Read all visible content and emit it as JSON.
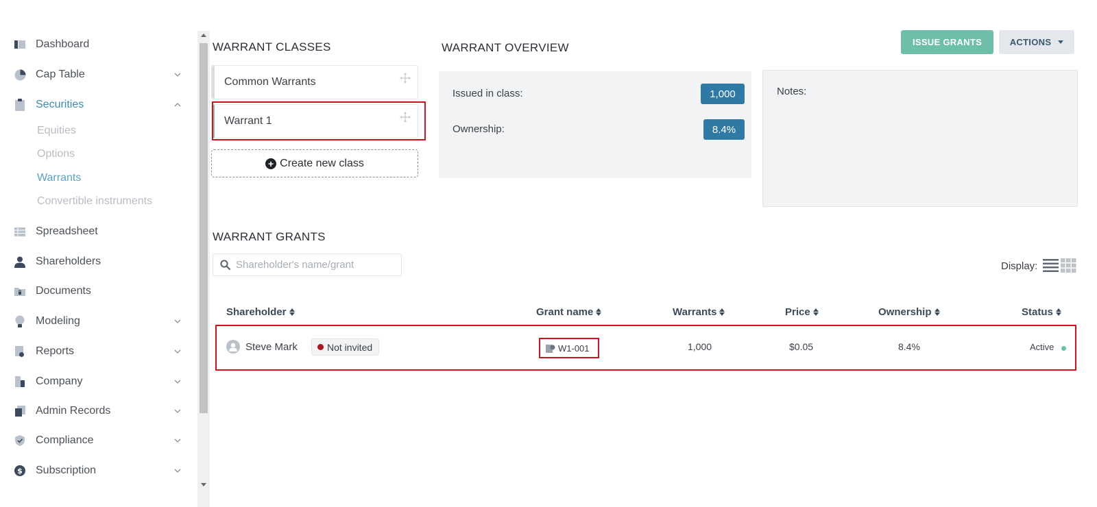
{
  "sidebar": {
    "items": [
      {
        "label": "Dashboard",
        "icon": "dashboard-icon",
        "has_chevron": false
      },
      {
        "label": "Cap Table",
        "icon": "pie-chart-icon",
        "has_chevron": true
      },
      {
        "label": "Securities",
        "icon": "clipboard-icon",
        "has_chevron": true,
        "expanded": true
      },
      {
        "label": "Spreadsheet",
        "icon": "spreadsheet-icon",
        "has_chevron": false
      },
      {
        "label": "Shareholders",
        "icon": "user-icon",
        "has_chevron": false
      },
      {
        "label": "Documents",
        "icon": "folder-lock-icon",
        "has_chevron": false
      },
      {
        "label": "Modeling",
        "icon": "lightbulb-icon",
        "has_chevron": true
      },
      {
        "label": "Reports",
        "icon": "report-icon",
        "has_chevron": true
      },
      {
        "label": "Company",
        "icon": "building-icon",
        "has_chevron": true
      },
      {
        "label": "Admin Records",
        "icon": "admin-records-icon",
        "has_chevron": true
      },
      {
        "label": "Compliance",
        "icon": "shield-check-icon",
        "has_chevron": true
      },
      {
        "label": "Subscription",
        "icon": "dollar-circle-icon",
        "has_chevron": true
      }
    ],
    "securities_sub": [
      {
        "label": "Equities",
        "active": false
      },
      {
        "label": "Options",
        "active": false
      },
      {
        "label": "Warrants",
        "active": true
      },
      {
        "label": "Convertible instruments",
        "active": false
      }
    ]
  },
  "classes": {
    "heading": "WARRANT CLASSES",
    "items": [
      {
        "label": "Common Warrants",
        "selected": false
      },
      {
        "label": "Warrant 1",
        "selected": true
      }
    ],
    "create_label": "Create new class"
  },
  "overview": {
    "heading": "WARRANT OVERVIEW",
    "issued_label": "Issued in class:",
    "issued_value": "1,000",
    "ownership_label": "Ownership:",
    "ownership_value": "8.4%",
    "notes_label": "Notes:"
  },
  "toolbar": {
    "issue_label": "ISSUE GRANTS",
    "actions_label": "ACTIONS"
  },
  "grants": {
    "heading": "WARRANT GRANTS",
    "search_placeholder": "Shareholder's name/grant",
    "display_label": "Display:",
    "columns": [
      "Shareholder",
      "Grant name",
      "Warrants",
      "Price",
      "Ownership",
      "Status"
    ],
    "rows": [
      {
        "shareholder": "Steve Mark",
        "invite_status": "Not invited",
        "grant_name": "W1-001",
        "warrants": "1,000",
        "price": "$0.05",
        "ownership": "8.4%",
        "status": "Active"
      }
    ]
  },
  "colors": {
    "accent_teal": "#6dbfa9",
    "badge_blue": "#2f7aa5",
    "highlight_red": "#d0121c",
    "not_invited_dot": "#b0151d"
  }
}
